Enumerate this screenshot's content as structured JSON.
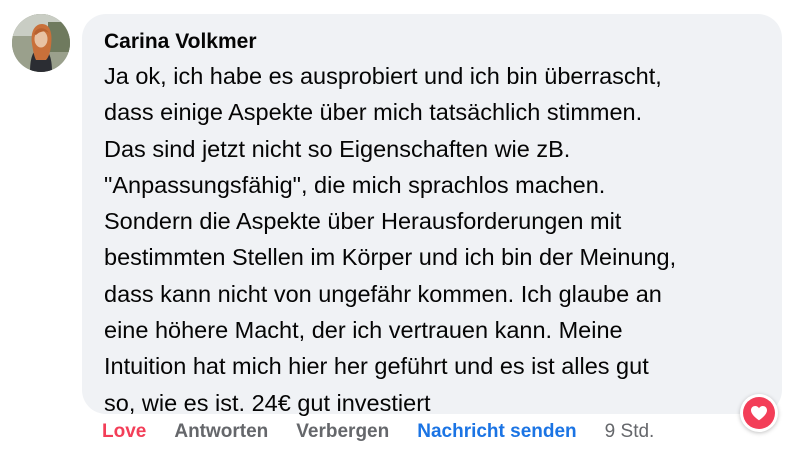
{
  "comment": {
    "author": "Carina Volkmer",
    "lines": [
      "Ja ok, ich habe es ausprobiert und ich bin überrascht,",
      "dass einige Aspekte über mich tatsächlich stimmen.",
      "Das sind jetzt nicht so Eigenschaften wie zB.",
      "\"Anpassungsfähig\", die mich sprachlos machen.",
      "Sondern die Aspekte über Herausforderungen mit",
      "bestimmten Stellen im Körper und ich bin der Meinung,",
      "dass kann nicht von ungefähr kommen. Ich glaube an",
      "eine höhere Macht, der ich vertrauen kann. Meine",
      "Intuition hat mich hier her geführt und es ist alles gut",
      "so, wie es ist. 24€ gut investiert"
    ]
  },
  "actions": {
    "love": "Love",
    "reply": "Antworten",
    "hide": "Verbergen",
    "send_message": "Nachricht senden",
    "timestamp": "9 Std."
  },
  "reaction": {
    "icon": "heart-icon",
    "color": "#f33e58"
  },
  "colors": {
    "bubble": "#f0f2f5",
    "love": "#f33e58",
    "link": "#1b74e4",
    "muted": "#65676b",
    "text": "#050505"
  }
}
